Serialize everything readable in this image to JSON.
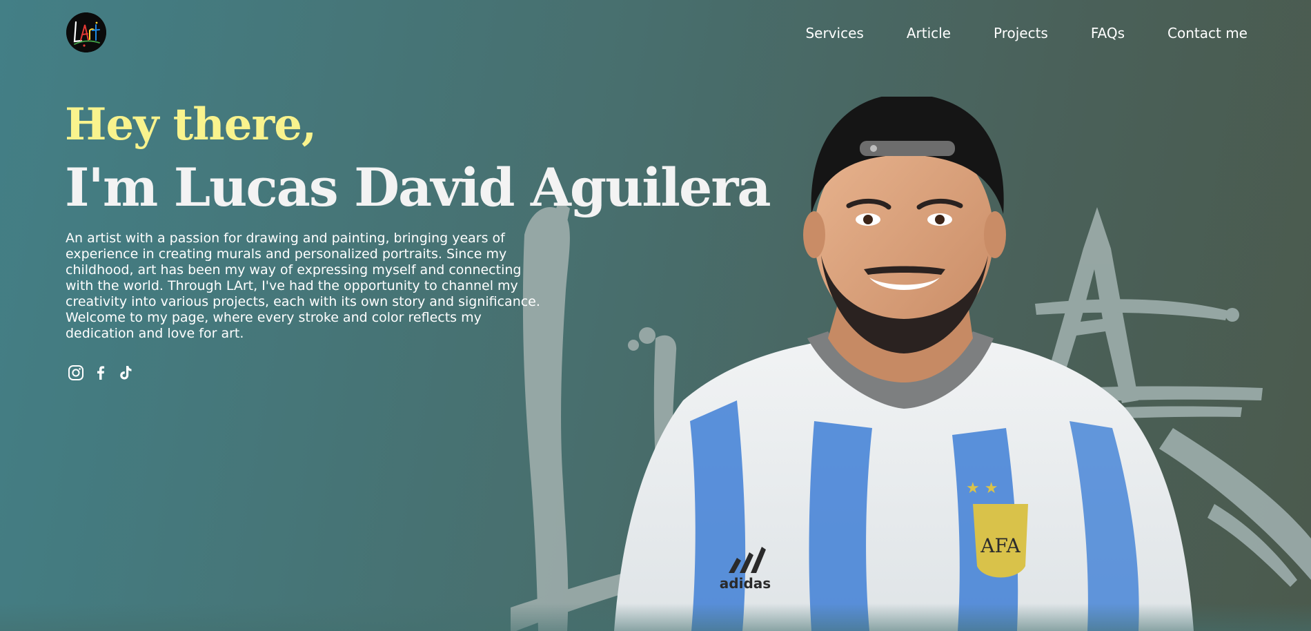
{
  "logo": {
    "text": "LArt",
    "colors": [
      "#e53935",
      "#fdd835",
      "#43a047",
      "#1e88e5",
      "#ffffff"
    ]
  },
  "nav": {
    "items": [
      {
        "label": "Services"
      },
      {
        "label": "Article"
      },
      {
        "label": "Projects"
      },
      {
        "label": "FAQs"
      },
      {
        "label": "Contact me"
      }
    ]
  },
  "hero": {
    "greeting": "Hey there,",
    "name": "I'm Lucas David Aguilera",
    "bio": "An artist with a passion for drawing and painting, bringing years of experience in creating murals and personalized portraits. Since my childhood, art has been my way of expressing myself and connecting with the world. Through LArt, I've had the opportunity to channel my creativity into various projects, each with its own story and significance. Welcome to my page, where every stroke and color reflects my dedication and love for art.",
    "social": [
      {
        "icon": "instagram-icon"
      },
      {
        "icon": "facebook-icon"
      },
      {
        "icon": "tiktok-icon"
      }
    ],
    "portrait_jersey_text": "AFA",
    "portrait_brand_text": "adidas"
  },
  "colors": {
    "accent": "#f9f38d",
    "heading": "#f3f3f3",
    "text": "#ffffff",
    "brush": "#9aaaa8",
    "bg_left": "#437f86",
    "bg_right": "#4b5a4d"
  }
}
